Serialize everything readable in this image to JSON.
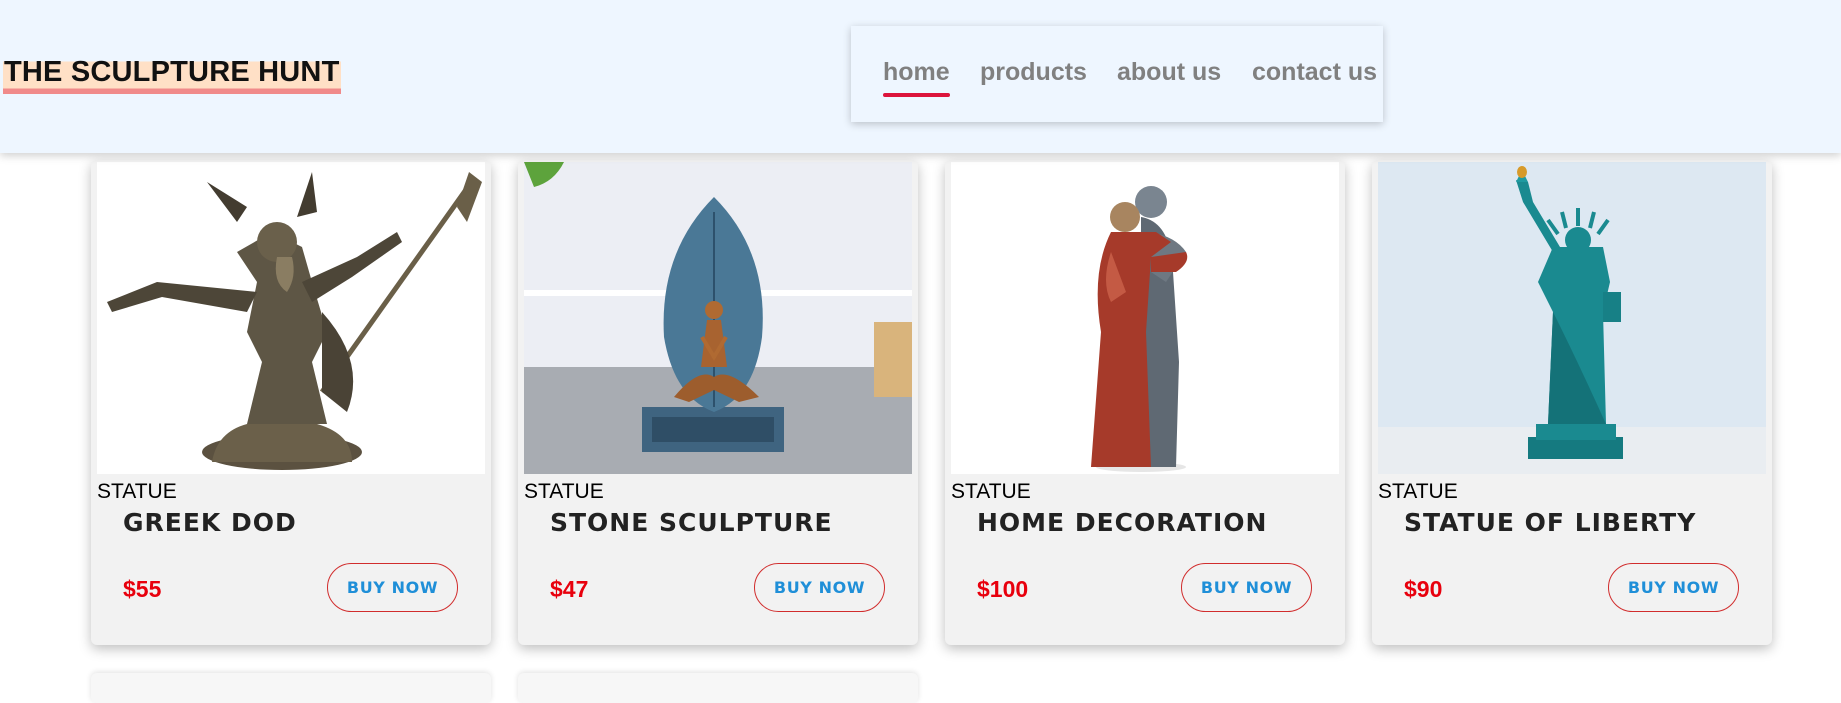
{
  "brand": "THE SCULPTURE HUNT",
  "nav": [
    {
      "label": "home",
      "active": true
    },
    {
      "label": "products",
      "active": false
    },
    {
      "label": "about us",
      "active": false
    },
    {
      "label": "contact us",
      "active": false
    }
  ],
  "products": [
    {
      "category": "STATUE",
      "name": "GREEK DOD",
      "price": "$55",
      "button": "BUY NOW",
      "image": "greek-god-bronze-statue"
    },
    {
      "category": "STATUE",
      "name": "STONE SCULPTURE",
      "price": "$47",
      "button": "BUY NOW",
      "image": "meditating-figure-leaf-sculpture"
    },
    {
      "category": "STATUE",
      "name": "HOME DECORATION",
      "price": "$100",
      "button": "BUY NOW",
      "image": "embracing-couple-figurine"
    },
    {
      "category": "STATUE",
      "name": "STATUE OF LIBERTY",
      "price": "$90",
      "button": "BUY NOW",
      "image": "statue-of-liberty-teal"
    }
  ],
  "colors": {
    "header_bg": "#eef6ff",
    "nav_active_underline": "#dc143c",
    "price": "#e8000d",
    "button_text": "#1f8fd8",
    "button_border": "#d12d2d",
    "card_bg": "#f2f2f2"
  }
}
